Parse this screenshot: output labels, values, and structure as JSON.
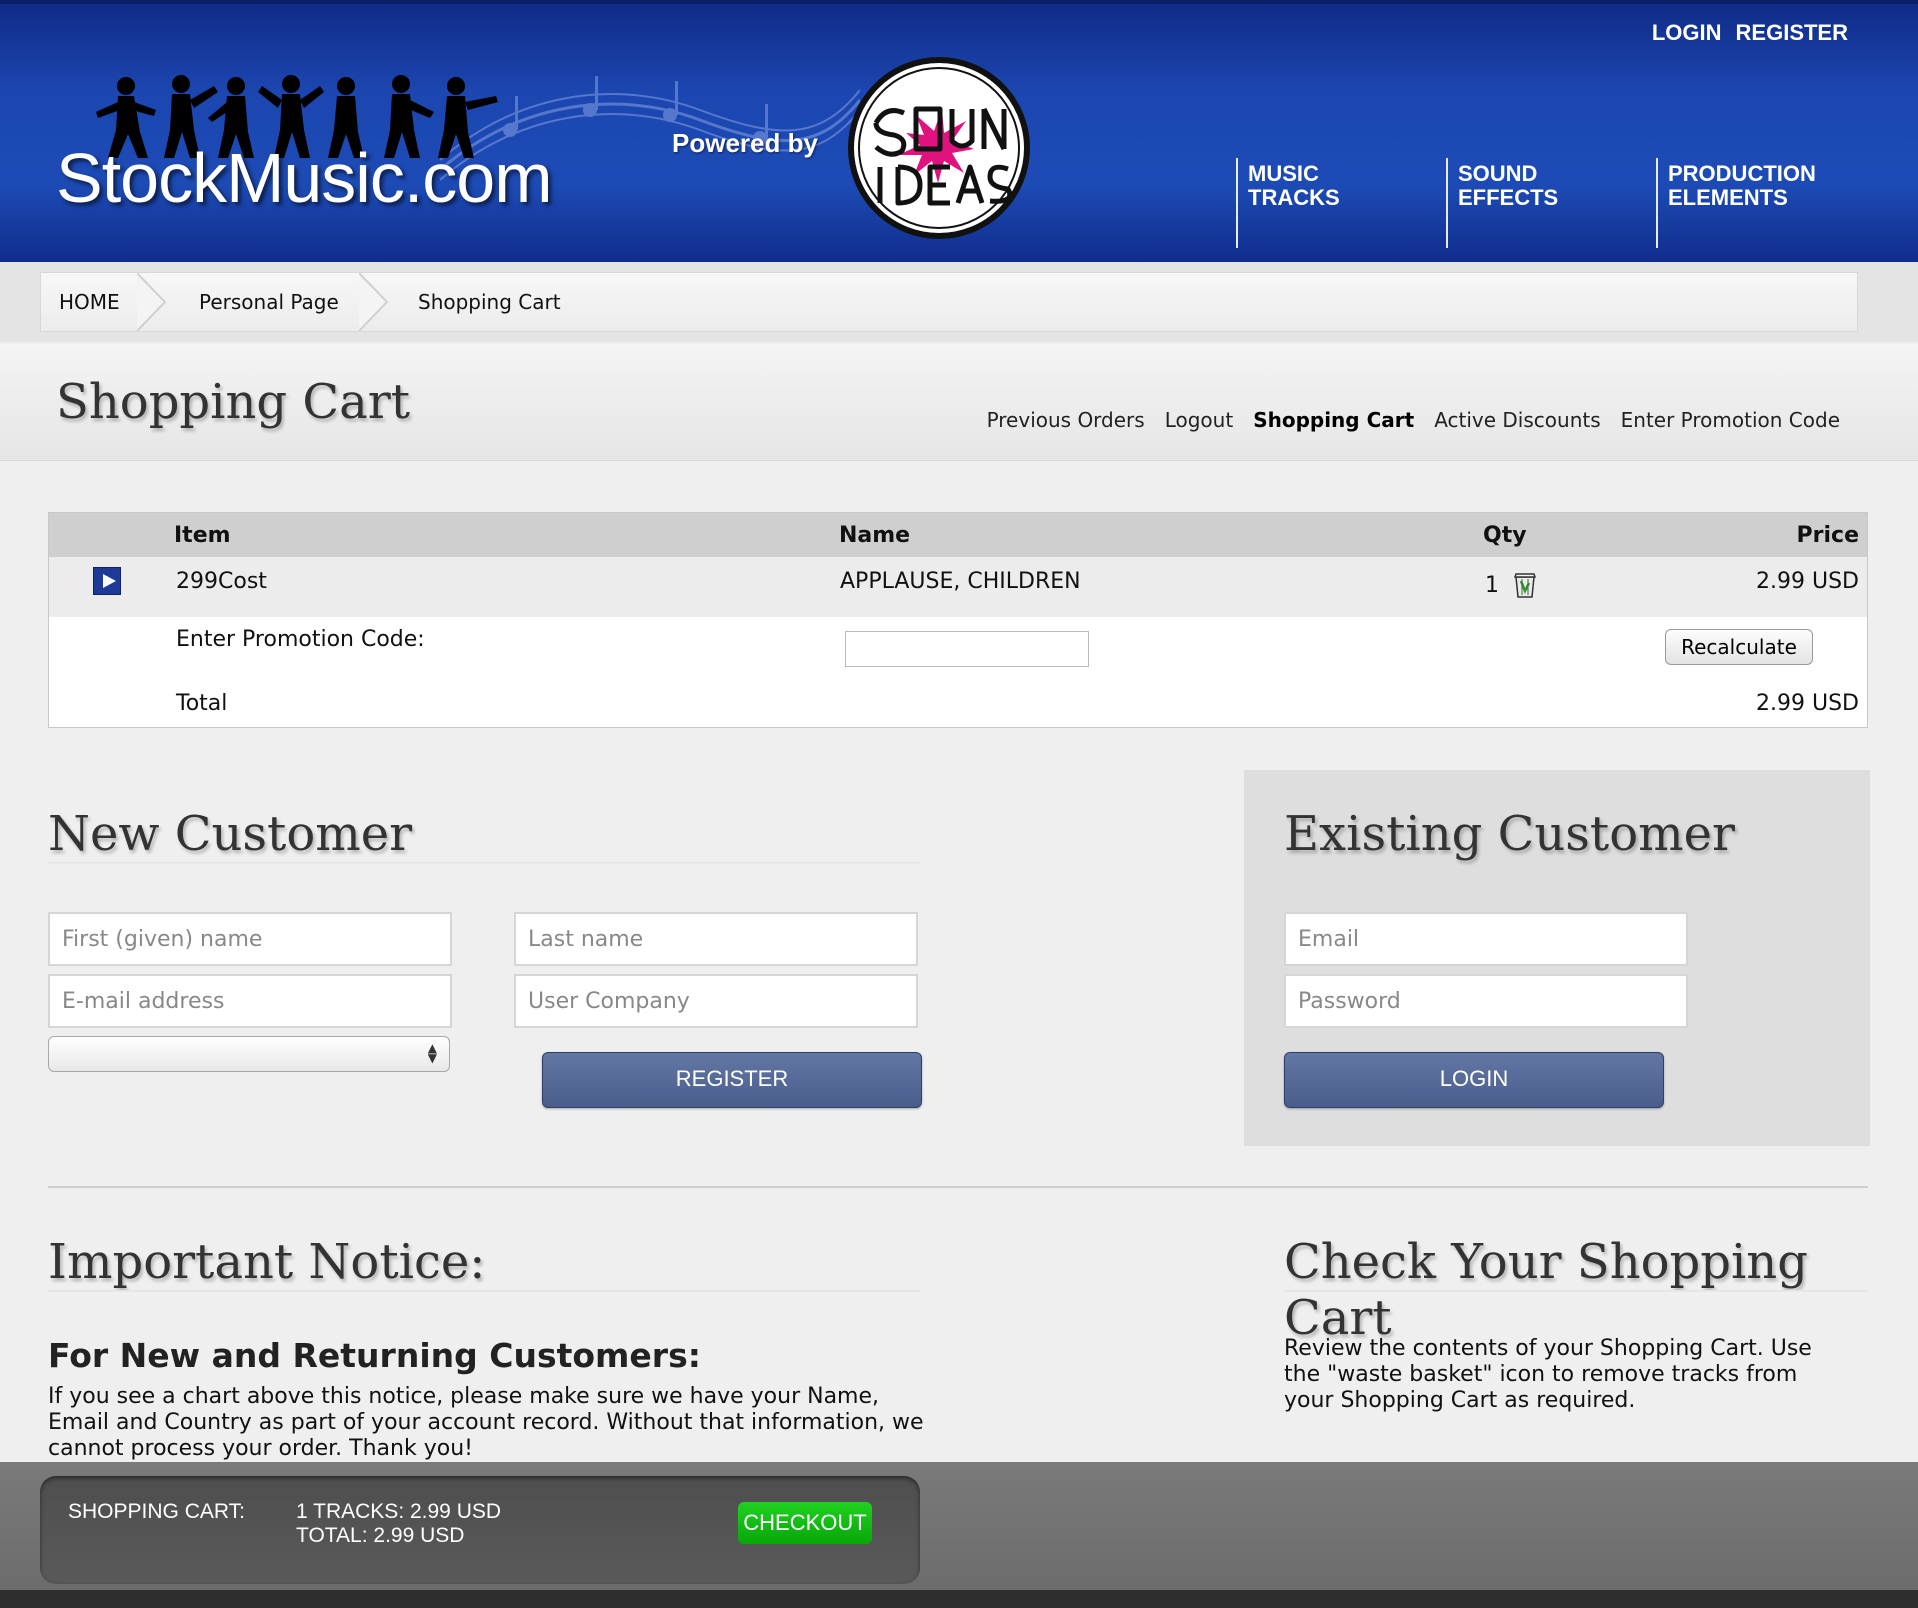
{
  "header": {
    "login_label": "LOGIN",
    "register_label": "REGISTER",
    "logo_text": "StockMusic.com",
    "powered_by": "Powered by",
    "partner_logo_alt": "SOUND IDEAS",
    "nav": [
      {
        "label": "MUSIC TRACKS"
      },
      {
        "label": "SOUND EFFECTS"
      },
      {
        "label": "PRODUCTION ELEMENTS"
      }
    ]
  },
  "breadcrumb": [
    "HOME",
    "Personal Page",
    "Shopping Cart"
  ],
  "page": {
    "title": "Shopping Cart",
    "subnav": [
      {
        "label": "Previous Orders",
        "active": false
      },
      {
        "label": "Logout",
        "active": false
      },
      {
        "label": "Shopping Cart",
        "active": true
      },
      {
        "label": "Active Discounts",
        "active": false
      },
      {
        "label": "Enter Promotion Code",
        "active": false
      }
    ]
  },
  "cart": {
    "headers": {
      "item": "Item",
      "name": "Name",
      "qty": "Qty",
      "price": "Price"
    },
    "rows": [
      {
        "item": "299Cost",
        "name": "APPLAUSE, CHILDREN",
        "qty": "1",
        "price": "2.99 USD"
      }
    ],
    "promo_label": "Enter Promotion Code:",
    "promo_value": "",
    "recalculate_label": "Recalculate",
    "total_label": "Total",
    "total_value": "2.99 USD"
  },
  "new_customer": {
    "title": "New Customer",
    "first_name_placeholder": "First (given) name",
    "last_name_placeholder": "Last name",
    "email_placeholder": "E-mail address",
    "company_placeholder": "User Company",
    "country_value": "",
    "register_label": "REGISTER"
  },
  "existing_customer": {
    "title": "Existing Customer",
    "email_placeholder": "Email",
    "password_placeholder": "Password",
    "login_label": "LOGIN"
  },
  "notice": {
    "title": "Important Notice:",
    "subtitle": "For New and Returning Customers:",
    "body": "If you see a chart above this notice, please make sure we have your Name, Email and Country as part of your account record. Without that information, we cannot process your order. Thank you!"
  },
  "check_cart": {
    "title": "Check Your Shopping Cart",
    "body": "Review the contents of your Shopping Cart. Use the \"waste basket\" icon to remove tracks from your Shopping Cart as required."
  },
  "bottom_cart": {
    "label": "SHOPPING CART:",
    "tracks": "1 TRACKS: 2.99 USD",
    "total": "TOTAL: 2.99 USD",
    "checkout_label": "CHECKOUT"
  },
  "colors": {
    "header_blue": "#1d4bb6",
    "button_blue": "#4a5d8c",
    "checkout_green": "#08a708",
    "partner_magenta": "#e0127e"
  }
}
